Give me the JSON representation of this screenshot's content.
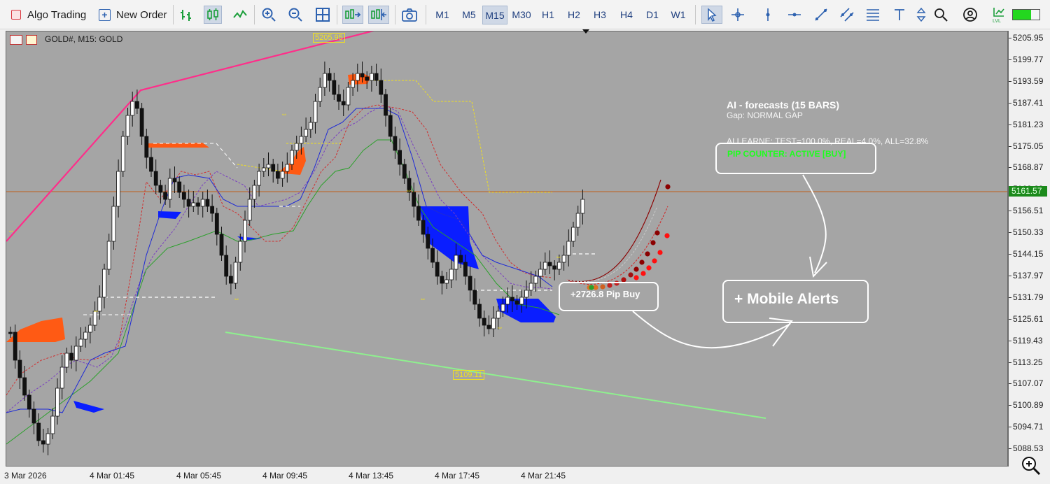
{
  "toolbar": {
    "algo_trading_label": "Algo Trading",
    "new_order_label": "New Order",
    "timeframes": [
      "M1",
      "M5",
      "M15",
      "M30",
      "H1",
      "H2",
      "H3",
      "H4",
      "D1",
      "W1"
    ],
    "active_timeframe": "M15"
  },
  "chart": {
    "symbol_label": "GOLD#, M15:  GOLD",
    "current_price": "5161.57",
    "high_label": "5205.95",
    "low_label": "5109.11",
    "price_labels": [
      "5205.95",
      "5199.77",
      "5193.59",
      "5187.41",
      "5181.23",
      "5175.05",
      "5168.87",
      "5162.69",
      "5156.51",
      "5150.33",
      "5144.15",
      "5137.97",
      "5131.79",
      "5125.61",
      "5119.43",
      "5113.25",
      "5107.07",
      "5100.89",
      "5094.71",
      "5088.53"
    ],
    "time_labels": [
      "3 Mar 2026",
      "4 Mar 01:45",
      "4 Mar 05:45",
      "4 Mar 09:45",
      "4 Mar 13:45",
      "4 Mar 17:45",
      "4 Mar 21:45"
    ],
    "colors": {
      "background": "#a5a5a5",
      "trendline": "#ff2d8a",
      "support_line": "#90ee90",
      "current_price_line": "#c0601b",
      "cloud_bull": "#ff5a14",
      "cloud_bear": "#0a1eff"
    }
  },
  "ai_panel": {
    "title": "AI - forecasts (15 BARS)",
    "gap": "Gap: NORMAL GAP",
    "learn_stats": "AI LEARNE: TEST=100.0%, REAL=4.0%, ALL=32.8%",
    "pip_counter": "PIP COUNTER: ACTIVE [BUY]",
    "pip_buy": "+2726.8 Pip Buy",
    "mobile_alerts": "+ Mobile Alerts"
  },
  "icons": {
    "algo_trading": "algo-trading-icon",
    "new_order": "new-order-icon",
    "zoom": "zoom-icon"
  }
}
